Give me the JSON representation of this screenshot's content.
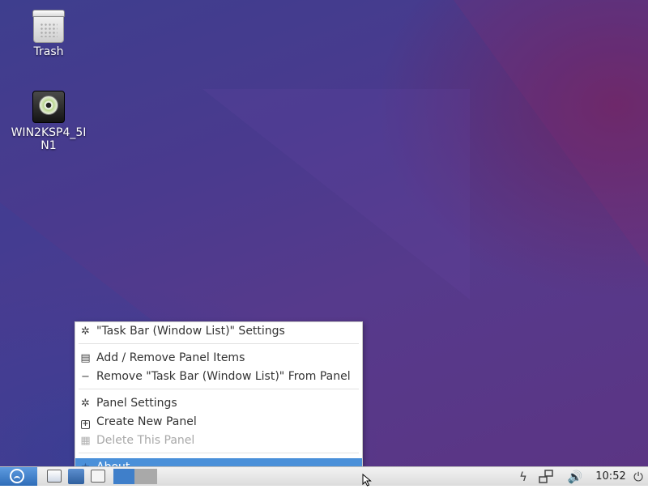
{
  "desktop": {
    "icons": [
      {
        "label": "Trash",
        "icon": "trash-icon"
      },
      {
        "label": "WIN2KSP4_5I\nN1",
        "icon": "optical-drive-icon"
      }
    ]
  },
  "context_menu": {
    "items": [
      {
        "label": "\"Task Bar (Window List)\" Settings",
        "icon": "gear-icon",
        "state": "normal"
      },
      {
        "label": "Add / Remove Panel Items",
        "icon": "list-document-icon",
        "state": "normal"
      },
      {
        "label": "Remove \"Task Bar (Window List)\" From Panel",
        "icon": "minus-icon",
        "state": "normal"
      },
      {
        "label": "Panel Settings",
        "icon": "gear-icon",
        "state": "normal"
      },
      {
        "label": "Create New Panel",
        "icon": "plus-box-icon",
        "state": "normal"
      },
      {
        "label": "Delete This Panel",
        "icon": "calendar-grid-icon",
        "state": "disabled"
      },
      {
        "label": "About",
        "icon": "star-icon",
        "state": "highlighted"
      }
    ]
  },
  "taskbar": {
    "clock": "10:52",
    "tray_icons": [
      "power-bolt-icon",
      "network-icon",
      "volume-icon",
      "power-button-icon"
    ]
  },
  "colors": {
    "menu_highlight": "#4a90d9",
    "panel_button": "#3f7fca"
  }
}
